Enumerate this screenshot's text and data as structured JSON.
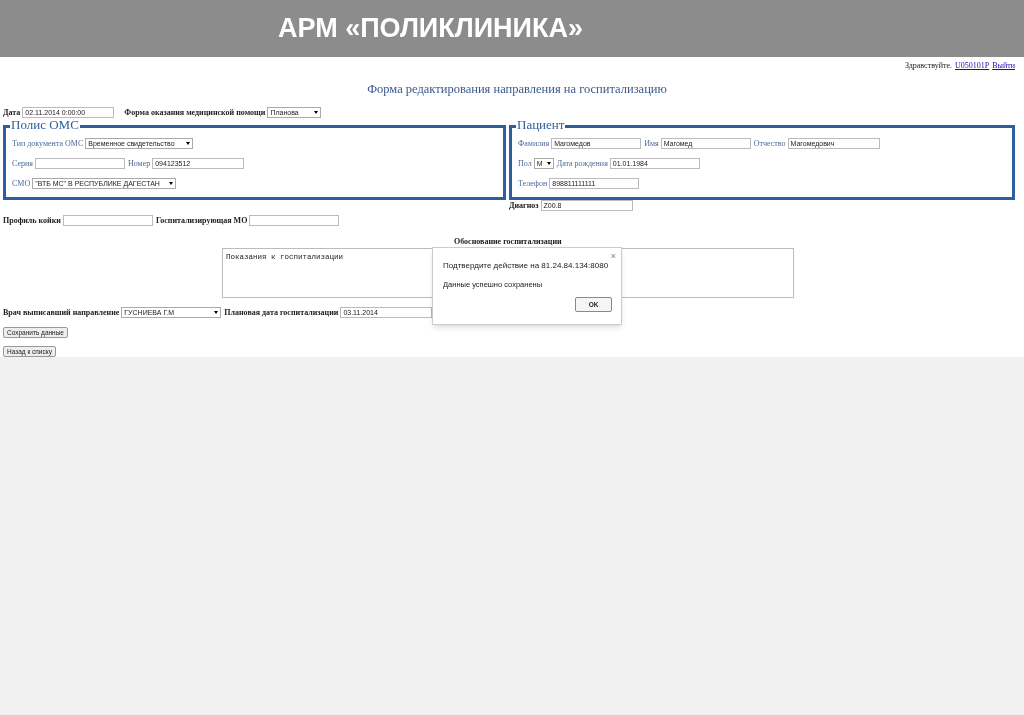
{
  "slide_title": "АРМ «ПОЛИКЛИНИКА»",
  "header": {
    "greeting": "Здравствуйте.",
    "user_link": "U050101P",
    "logout_link": "Выйти"
  },
  "form_title": "Форма редактирования направления на госпитализацию",
  "top_row": [
    {
      "label": "Дата",
      "value": "02.11.2014 0:00:00",
      "kind": "text"
    },
    {
      "label": "Форма оказания медицинской помощи",
      "value": "Планова",
      "kind": "select"
    }
  ],
  "policy": {
    "legend": "Полис ОМС",
    "rows": [
      [
        {
          "label": "Тип документа ОМС",
          "value": "Временное свидетельство",
          "kind": "select"
        }
      ],
      [
        {
          "label": "Серия",
          "kind": "text"
        },
        {
          "label": "Номер",
          "value": "094123512",
          "kind": "text"
        }
      ],
      [
        {
          "label": "СМО",
          "value": "\"ВТБ МС\" В РЕСПУБЛИКЕ ДАГЕСТАН",
          "kind": "select"
        }
      ]
    ]
  },
  "patient": {
    "legend": "Пациент",
    "rows": [
      [
        {
          "label": "Фамилия",
          "value": "Магомедов",
          "kind": "text"
        },
        {
          "label": "Имя",
          "value": "Магомед",
          "kind": "text"
        },
        {
          "label": "Отчество",
          "value": "Магомедович",
          "kind": "text"
        }
      ],
      [
        {
          "label": "Пол",
          "value": "М",
          "kind": "select"
        },
        {
          "label": "Дата рождения",
          "value": "01.01.1984",
          "kind": "text"
        }
      ],
      [
        {
          "label": "Телефон",
          "value": "898811111111",
          "kind": "text"
        }
      ]
    ]
  },
  "diagnosis": {
    "label": "Диагноз",
    "value": "Z00.8",
    "kind": "text"
  },
  "profile_row": [
    {
      "label": "Профиль койки",
      "kind": "text"
    },
    {
      "label": "Госпитализирующая МО",
      "kind": "text"
    }
  ],
  "justification": {
    "label": "Обоснование госпитализации",
    "value": "Показания к госпитализации"
  },
  "doctor_row": [
    {
      "label": "Врач выписавший направление",
      "value": "ГУСНИЕВА Г.М",
      "kind": "select"
    },
    {
      "label": "Плановая дата госпитализации",
      "value": "03.11.2014",
      "kind": "text"
    }
  ],
  "buttons": [
    "Сохранить данные",
    "Назад к списку"
  ],
  "dialog": {
    "title": "Подтвердите действие на 81.24.84.134:8080",
    "close": "×",
    "message": "Данные успешно сохранены",
    "ok": "OK"
  }
}
